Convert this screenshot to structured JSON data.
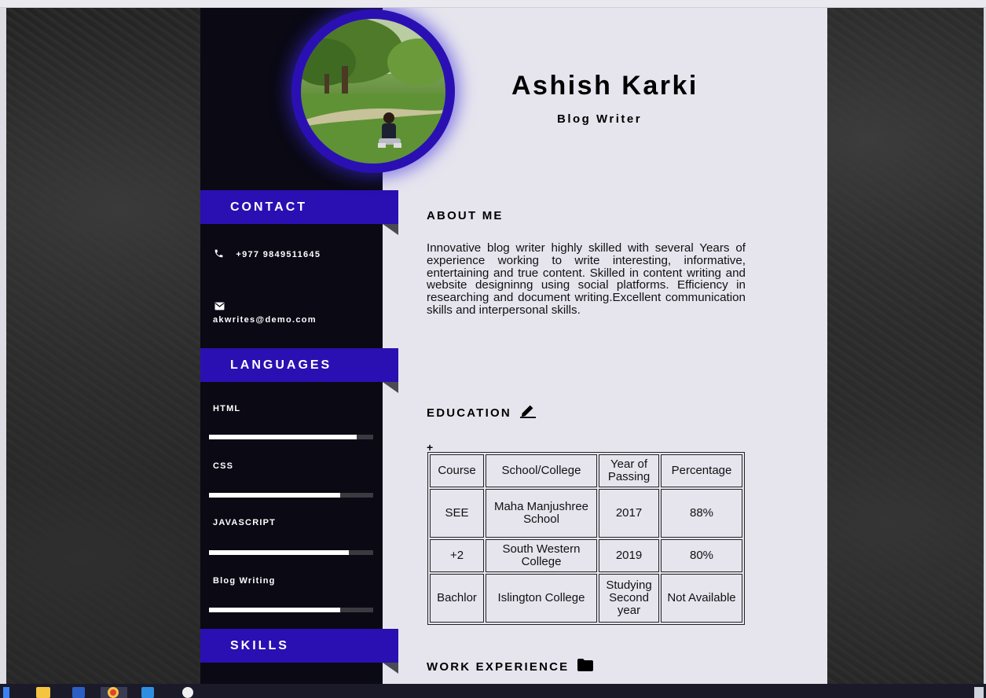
{
  "profile": {
    "name": "Ashish Karki",
    "title": "Blog Writer"
  },
  "sidebar": {
    "contact_heading": "CONTACT",
    "phone": "+977 9849511645",
    "email": "akwrites@demo.com",
    "languages_heading": "LANGUAGES",
    "languages": [
      {
        "name": "HTML",
        "level": 0.9
      },
      {
        "name": "CSS",
        "level": 0.8
      },
      {
        "name": "JAVASCRIPT",
        "level": 0.85
      },
      {
        "name": "Blog Writing",
        "level": 0.8
      }
    ],
    "skills_heading": "SKILLS"
  },
  "about": {
    "heading": "ABOUT ME",
    "text": "Innovative blog writer highly skilled with several Years of experience working to write interesting, informative, entertaining and true content. Skilled in content writing and website designinng using social platforms. Efficiency in researching and document writing.Excellent communication skills and interpersonal skills."
  },
  "education": {
    "heading": "EDUCATION",
    "add_label": "+",
    "columns": [
      "Course",
      "School/College",
      "Year of Passing",
      "Percentage"
    ],
    "rows": [
      [
        "SEE",
        "Maha Manjushree School",
        "2017",
        "88%"
      ],
      [
        "+2",
        "South Western College",
        "2019",
        "80%"
      ],
      [
        "Bachlor",
        "Islington College",
        "Studying Second year",
        "Not Available"
      ]
    ]
  },
  "work": {
    "heading": "WORK EXPERIENCE"
  },
  "colors": {
    "accent": "#2a10b2",
    "sidebar": "#0a0914",
    "main_bg": "#e6e5ee"
  },
  "icons": [
    "phone-icon",
    "mail-icon",
    "pencil-icon",
    "folder-icon"
  ]
}
